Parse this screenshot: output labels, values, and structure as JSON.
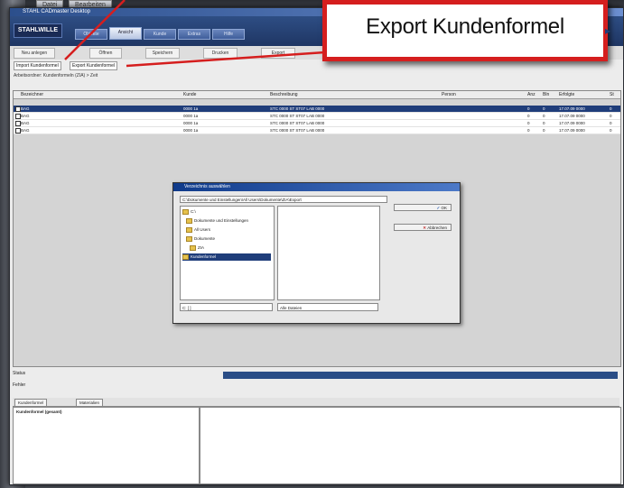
{
  "desktop_tabs": [
    "Datei",
    "Bearbeiten"
  ],
  "window": {
    "title": "STAHL CADmaster Desktop"
  },
  "header": {
    "logo": "STAHLWILLE",
    "tabs": [
      {
        "label": "Objekte"
      },
      {
        "label": "Ansicht"
      },
      {
        "label": "Kunde"
      },
      {
        "label": "Extras"
      },
      {
        "label": "Hilfe"
      }
    ],
    "active_tab_index": 1
  },
  "toolbar": {
    "buttons": [
      "Neu anlegen",
      "Öffnen",
      "Speichern",
      "Drucken",
      "Export"
    ]
  },
  "subtoolbar": {
    "import_label": "Import Kundenformel",
    "export_label": "Export Kundenformel"
  },
  "path_label": "Arbeitsordner: Kundenformeln (ZIA) > Zeit",
  "grid": {
    "columns": [
      "Bezeichner",
      "Kunde",
      "Beschreibung",
      "Person",
      "Anz",
      "Bln",
      "Erfolgte",
      "St"
    ],
    "rows": [
      {
        "cells": [
          "BAG",
          "0000 1a",
          "STC 0000 ST ST07 LAB 0000",
          "",
          "0",
          "0",
          "17.07.09 0000",
          "0"
        ],
        "selected": true
      },
      {
        "cells": [
          "BAG",
          "0000 1a",
          "STC 0000 ST ST07 LAB 0000",
          "",
          "0",
          "0",
          "17.07.09 0000",
          "0"
        ],
        "selected": false
      },
      {
        "cells": [
          "BAG",
          "0000 1a",
          "STC 0000 ST ST07 LAB 0000",
          "",
          "0",
          "0",
          "17.07.09 0000",
          "0"
        ],
        "selected": false
      },
      {
        "cells": [
          "BAG",
          "0000 1a",
          "STC 0000 ST ST07 LAB 0000",
          "",
          "0",
          "0",
          "17.07.09 0000",
          "0"
        ],
        "selected": false
      }
    ]
  },
  "dialog": {
    "title": "Verzeichnis auswählen",
    "path": "C:\\Dokumente und Einstellungen\\All Users\\Dokumente\\ZIA\\Export",
    "tree": [
      {
        "label": "C:\\",
        "selected": false
      },
      {
        "label": "Dokumente und Einstellungen",
        "selected": false
      },
      {
        "label": "All Users",
        "selected": false
      },
      {
        "label": "Dokumente",
        "selected": false
      },
      {
        "label": "ZIA",
        "selected": false
      },
      {
        "label": "Kundenformel",
        "selected": true
      }
    ],
    "ok_label": "OK",
    "cancel_label": "Abbrechen",
    "drive_value": "C: [ ]",
    "filter_value": "Alle Dateien"
  },
  "status": {
    "line1": "Status",
    "line2": "Fehler"
  },
  "bottom_tabs": [
    "Kundenformel",
    "Materialien"
  ],
  "bottom_left_header": "Kundenformel (gesamt)",
  "callout": {
    "text": "Export Kundenformel",
    "border_color": "#d51e1e"
  }
}
